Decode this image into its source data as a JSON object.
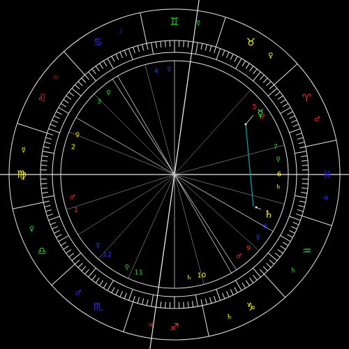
{
  "colors": {
    "background": "#000000",
    "lines": "#e8e8e8",
    "fire": "#ff2a2a",
    "earth": "#ffff00",
    "air": "#2f2fff",
    "water": "#22dd22",
    "aspect": "#00b0b0"
  },
  "signs": [
    {
      "name": "aries-sign",
      "glyph": "♈",
      "element": "fire"
    },
    {
      "name": "taurus-sign",
      "glyph": "♉",
      "element": "earth"
    },
    {
      "name": "gemini-sign",
      "glyph": "♊",
      "element": "water"
    },
    {
      "name": "cancer-sign",
      "glyph": "♋",
      "element": "air"
    },
    {
      "name": "leo-sign",
      "glyph": "♌",
      "element": "fire"
    },
    {
      "name": "virgo-sign",
      "glyph": "♍",
      "element": "earth"
    },
    {
      "name": "libra-sign",
      "glyph": "♎",
      "element": "water"
    },
    {
      "name": "scorpio-sign",
      "glyph": "♏",
      "element": "air"
    },
    {
      "name": "sagittarius-sign",
      "glyph": "♐",
      "element": "fire"
    },
    {
      "name": "capricorn-sign",
      "glyph": "♑",
      "element": "earth"
    },
    {
      "name": "aquarius-sign",
      "glyph": "♒",
      "element": "water"
    },
    {
      "name": "pisces-sign",
      "glyph": "♓",
      "element": "air"
    }
  ],
  "sign_rulers": [
    {
      "name": "aries-ruler",
      "glyph": "♂",
      "element": "fire"
    },
    {
      "name": "taurus-ruler",
      "glyph": "♀",
      "element": "earth"
    },
    {
      "name": "gemini-ruler",
      "glyph": "☿",
      "element": "water"
    },
    {
      "name": "cancer-ruler",
      "glyph": "☽",
      "element": "air"
    },
    {
      "name": "leo-ruler",
      "glyph": "☉",
      "element": "fire"
    },
    {
      "name": "virgo-ruler",
      "glyph": "☿",
      "element": "earth"
    },
    {
      "name": "libra-ruler",
      "glyph": "♀",
      "element": "water"
    },
    {
      "name": "scorpio-ruler",
      "glyph": "♂",
      "element": "air"
    },
    {
      "name": "sagittarius-ruler",
      "glyph": "♃",
      "element": "fire"
    },
    {
      "name": "capricorn-ruler",
      "glyph": "♄",
      "element": "earth"
    },
    {
      "name": "aquarius-ruler",
      "glyph": "♄",
      "element": "water"
    },
    {
      "name": "pisces-ruler",
      "glyph": "♃",
      "element": "air"
    }
  ],
  "houses": [
    {
      "number": "1",
      "element": "fire"
    },
    {
      "number": "2",
      "element": "earth"
    },
    {
      "number": "3",
      "element": "water"
    },
    {
      "number": "4",
      "element": "air"
    },
    {
      "number": "5",
      "element": "fire"
    },
    {
      "number": "6",
      "element": "earth"
    },
    {
      "number": "7",
      "element": "water"
    },
    {
      "number": "8",
      "element": "air"
    },
    {
      "number": "9",
      "element": "fire"
    },
    {
      "number": "10",
      "element": "earth"
    },
    {
      "number": "11",
      "element": "water"
    },
    {
      "number": "12",
      "element": "air"
    }
  ],
  "house_rulers": [
    {
      "name": "house-1-ruler",
      "glyph": "♂",
      "element": "fire"
    },
    {
      "name": "house-2-ruler",
      "glyph": "♀",
      "element": "earth"
    },
    {
      "name": "house-3-ruler",
      "glyph": "♀",
      "element": "water"
    },
    {
      "name": "house-4-ruler",
      "glyph": "♀",
      "element": "air"
    },
    {
      "name": "house-5-ruler",
      "glyph": "♂",
      "element": "fire"
    },
    {
      "name": "house-6-ruler",
      "glyph": "♄",
      "element": "earth"
    },
    {
      "name": "house-7-ruler",
      "glyph": "♀",
      "element": "water"
    },
    {
      "name": "house-8-ruler",
      "glyph": "♀",
      "element": "air"
    },
    {
      "name": "house-9-ruler",
      "glyph": "♂",
      "element": "fire"
    },
    {
      "name": "house-10-ruler",
      "glyph": "♄",
      "element": "earth"
    },
    {
      "name": "house-11-ruler",
      "glyph": "♀",
      "element": "water"
    },
    {
      "name": "house-12-ruler",
      "glyph": "♀",
      "element": "air"
    }
  ],
  "planets": [
    {
      "name": "mercury-planet",
      "glyph": "☿",
      "color": "#33ff33"
    },
    {
      "name": "saturn-planet",
      "glyph": "♄",
      "color": "#ffff00"
    }
  ]
}
